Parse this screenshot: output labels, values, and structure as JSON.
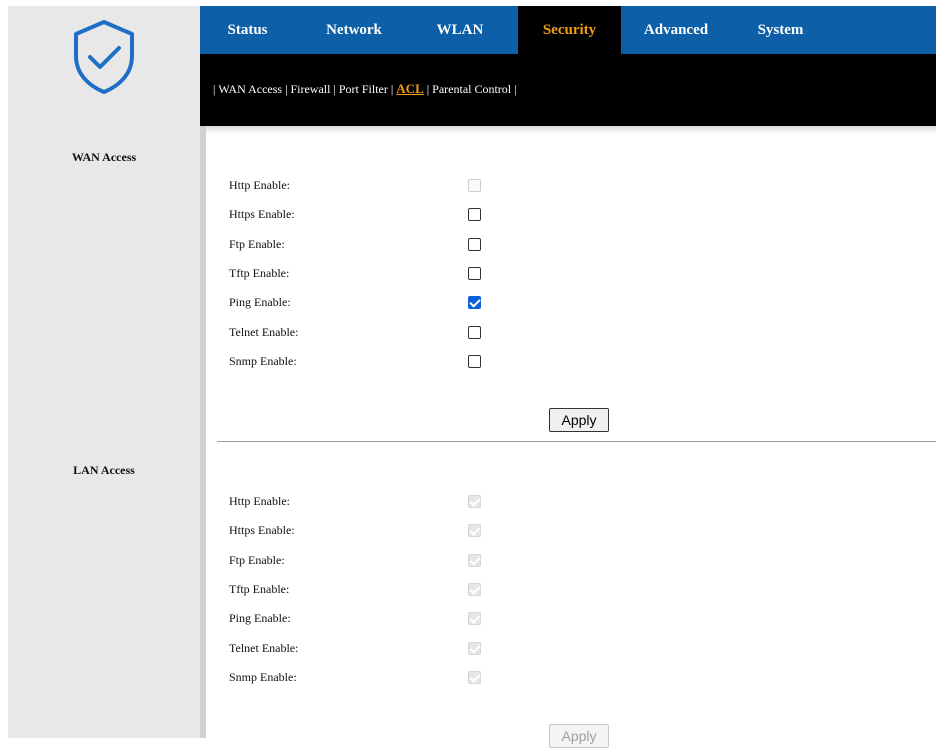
{
  "nav": {
    "tabs": [
      {
        "label": "Status"
      },
      {
        "label": "Network"
      },
      {
        "label": "WLAN"
      },
      {
        "label": "Security"
      },
      {
        "label": "Advanced"
      },
      {
        "label": "System"
      }
    ],
    "active_tab": "Security"
  },
  "subnav": {
    "items": [
      {
        "label": "WAN Access"
      },
      {
        "label": "Firewall"
      },
      {
        "label": "Port Filter"
      },
      {
        "label": "ACL"
      },
      {
        "label": "Parental Control"
      }
    ],
    "active_item": "ACL"
  },
  "wan": {
    "title": "WAN Access",
    "options": [
      {
        "label": "Http Enable:",
        "checked": false,
        "disabled": true
      },
      {
        "label": "Https Enable:",
        "checked": false,
        "disabled": false
      },
      {
        "label": "Ftp Enable:",
        "checked": false,
        "disabled": false
      },
      {
        "label": "Tftp Enable:",
        "checked": false,
        "disabled": false
      },
      {
        "label": "Ping Enable:",
        "checked": true,
        "disabled": false
      },
      {
        "label": "Telnet Enable:",
        "checked": false,
        "disabled": false
      },
      {
        "label": "Snmp Enable:",
        "checked": false,
        "disabled": false
      }
    ],
    "apply_label": "Apply"
  },
  "lan": {
    "title": "LAN Access",
    "options": [
      {
        "label": "Http Enable:",
        "checked": true,
        "disabled": true
      },
      {
        "label": "Https Enable:",
        "checked": true,
        "disabled": true
      },
      {
        "label": "Ftp Enable:",
        "checked": true,
        "disabled": true
      },
      {
        "label": "Tftp Enable:",
        "checked": true,
        "disabled": true
      },
      {
        "label": "Ping Enable:",
        "checked": true,
        "disabled": true
      },
      {
        "label": "Telnet Enable:",
        "checked": true,
        "disabled": true
      },
      {
        "label": "Snmp Enable:",
        "checked": true,
        "disabled": true
      }
    ],
    "apply_label": "Apply"
  },
  "colors": {
    "nav_bg": "#0d5fa8",
    "active_accent": "#f39c12",
    "subnav_bg": "#000000",
    "sidebar_bg": "#e8e8e8",
    "checkbox_checked": "#0b62d8"
  },
  "icons": {
    "logo": "shield-check-icon"
  }
}
